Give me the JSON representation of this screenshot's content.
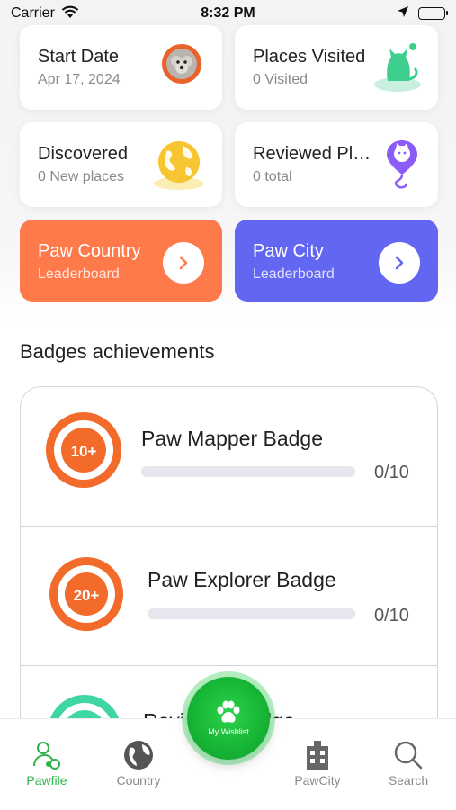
{
  "status": {
    "carrier": "Carrier",
    "time": "8:32 PM"
  },
  "stats": {
    "start": {
      "title": "Start Date",
      "sub": "Apr 17, 2024",
      "icon": "dog-avatar-icon"
    },
    "places": {
      "title": "Places Visited",
      "sub": "0 Visited",
      "icon": "cat-icon"
    },
    "discovered": {
      "title": "Discovered",
      "sub": "0 New places",
      "icon": "globe-icon"
    },
    "reviewed": {
      "title": "Reviewed Places",
      "sub": "0 total",
      "icon": "map-pin-cat-icon"
    }
  },
  "leaderboards": {
    "country": {
      "title": "Paw Country",
      "sub": "Leaderboard",
      "color": "#ff7a4a"
    },
    "city": {
      "title": "Paw City",
      "sub": "Leaderboard",
      "color": "#6366f1"
    }
  },
  "badges_title": "Badges achievements",
  "badges": [
    {
      "name": "Paw Mapper Badge",
      "medal": "10+",
      "progress": 0,
      "count": "0/10"
    },
    {
      "name": "Paw Explorer Badge",
      "medal": "20+",
      "progress": 0,
      "count": "0/10"
    },
    {
      "name": "Reviewer Badge",
      "medal": ""
    }
  ],
  "fab": {
    "label": "My Wishlist"
  },
  "tabs": [
    {
      "label": "Pawfile",
      "active": true
    },
    {
      "label": "Country"
    },
    {
      "label": "PawCity"
    },
    {
      "label": "Search"
    }
  ],
  "colors": {
    "accent_green": "#2fb34a",
    "orange": "#ff7a4a",
    "purple": "#6366f1"
  }
}
